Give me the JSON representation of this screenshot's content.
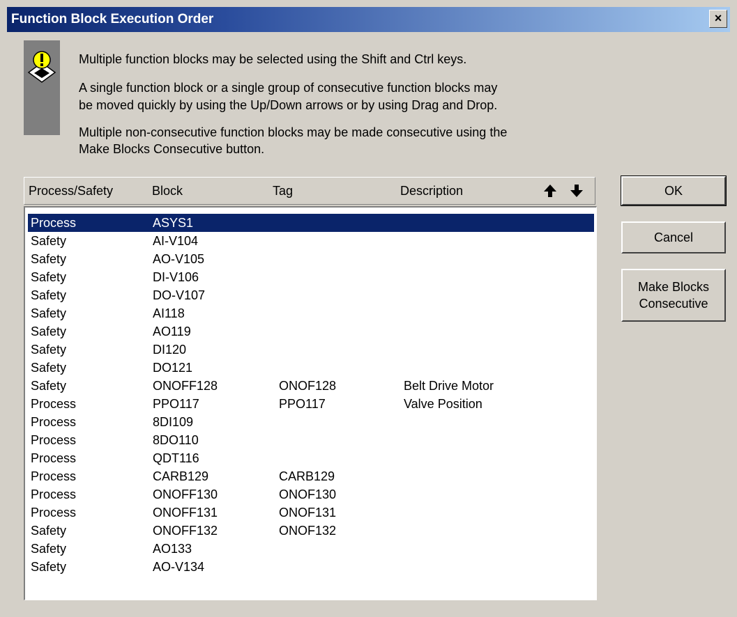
{
  "window": {
    "title": "Function Block Execution Order",
    "close_label": "×"
  },
  "instructions": {
    "icon": "warning-icon",
    "line1": "Multiple function blocks may be selected using the Shift and Ctrl keys.",
    "line2a": "A single function block or a single group of consecutive function blocks may",
    "line2b": "be moved quickly by using the Up/Down arrows or by using Drag and Drop.",
    "line3a": "Multiple non-consecutive function blocks may be made consecutive using the",
    "line3b": "Make Blocks Consecutive button."
  },
  "list": {
    "columns": {
      "process_safety": "Process/Safety",
      "block": "Block",
      "tag": "Tag",
      "description": "Description"
    },
    "move_up_icon": "arrow-up-icon",
    "move_down_icon": "arrow-down-icon",
    "selected_row": 0,
    "rows": [
      {
        "type": "Process",
        "block": "ASYS1",
        "tag": "",
        "description": ""
      },
      {
        "type": "Safety",
        "block": "AI-V104",
        "tag": "",
        "description": ""
      },
      {
        "type": "Safety",
        "block": "AO-V105",
        "tag": "",
        "description": ""
      },
      {
        "type": "Safety",
        "block": "DI-V106",
        "tag": "",
        "description": ""
      },
      {
        "type": "Safety",
        "block": "DO-V107",
        "tag": "",
        "description": ""
      },
      {
        "type": "Safety",
        "block": "AI118",
        "tag": "",
        "description": ""
      },
      {
        "type": "Safety",
        "block": "AO119",
        "tag": "",
        "description": ""
      },
      {
        "type": "Safety",
        "block": "DI120",
        "tag": "",
        "description": ""
      },
      {
        "type": "Safety",
        "block": "DO121",
        "tag": "",
        "description": ""
      },
      {
        "type": "Safety",
        "block": "ONOFF128",
        "tag": "ONOF128",
        "description": "Belt Drive Motor"
      },
      {
        "type": "Process",
        "block": "PPO117",
        "tag": "PPO117",
        "description": "Valve Position"
      },
      {
        "type": "Process",
        "block": "8DI109",
        "tag": "",
        "description": ""
      },
      {
        "type": "Process",
        "block": "8DO110",
        "tag": "",
        "description": ""
      },
      {
        "type": "Process",
        "block": "QDT116",
        "tag": "",
        "description": ""
      },
      {
        "type": "Process",
        "block": "CARB129",
        "tag": "CARB129",
        "description": ""
      },
      {
        "type": "Process",
        "block": "ONOFF130",
        "tag": "ONOF130",
        "description": ""
      },
      {
        "type": "Process",
        "block": "ONOFF131",
        "tag": "ONOF131",
        "description": ""
      },
      {
        "type": "Safety",
        "block": "ONOFF132",
        "tag": "ONOF132",
        "description": ""
      },
      {
        "type": "Safety",
        "block": "AO133",
        "tag": "",
        "description": ""
      },
      {
        "type": "Safety",
        "block": "AO-V134",
        "tag": "",
        "description": ""
      }
    ]
  },
  "buttons": {
    "ok": "OK",
    "cancel": "Cancel",
    "make_consecutive_line1": "Make Blocks",
    "make_consecutive_line2": "Consecutive"
  },
  "colors": {
    "selection": "#0a246a",
    "dialog_face": "#d4d0c8"
  }
}
